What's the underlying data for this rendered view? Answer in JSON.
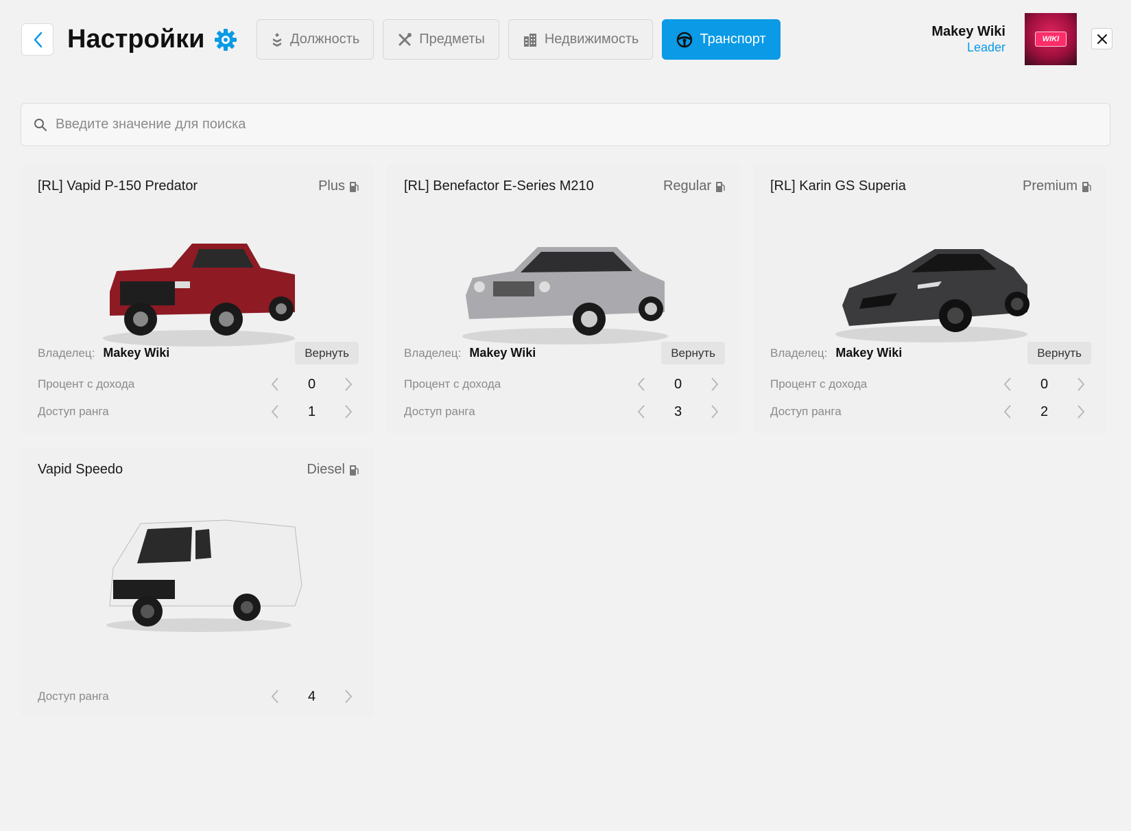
{
  "header": {
    "title": "Настройки",
    "tabs": [
      {
        "label": "Должность",
        "icon": "rank-icon",
        "active": false
      },
      {
        "label": "Предметы",
        "icon": "tools-icon",
        "active": false
      },
      {
        "label": "Недвижимость",
        "icon": "building-icon",
        "active": false
      },
      {
        "label": "Транспорт",
        "icon": "steering-wheel-icon",
        "active": true
      }
    ],
    "user": {
      "name": "Makey Wiki",
      "role": "Leader",
      "avatar_text": "WIKI"
    }
  },
  "search": {
    "placeholder": "Введите значение для поиска"
  },
  "labels": {
    "owner": "Владелец:",
    "return": "Вернуть",
    "income_percent": "Процент с дохода",
    "rank_access": "Доступ ранга"
  },
  "vehicles": [
    {
      "name": "[RL] Vapid P-150 Predator",
      "fuel": "Plus",
      "owner": "Makey Wiki",
      "income_percent": "0",
      "rank_access": "1",
      "color": "#8e1a24"
    },
    {
      "name": "[RL] Benefactor E-Series M210",
      "fuel": "Regular",
      "owner": "Makey Wiki",
      "income_percent": "0",
      "rank_access": "3",
      "color": "#a9a9ae"
    },
    {
      "name": "[RL] Karin GS Superia",
      "fuel": "Premium",
      "owner": "Makey Wiki",
      "income_percent": "0",
      "rank_access": "2",
      "color": "#3b3b3e"
    },
    {
      "name": "Vapid Speedo",
      "fuel": "Diesel",
      "rank_access": "4",
      "color": "#eeeeee"
    }
  ],
  "colors": {
    "accent": "#0a9ae6",
    "background": "#f2f2f2"
  }
}
